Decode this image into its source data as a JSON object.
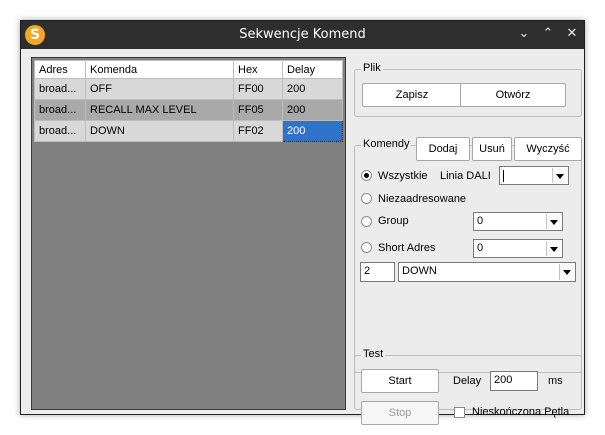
{
  "window": {
    "title": "Sekwencje Komend",
    "icon": "app-logo-icon"
  },
  "table": {
    "columns": [
      "Adres",
      "Komenda",
      "Hex",
      "Delay"
    ],
    "rows": [
      [
        "broad...",
        "OFF",
        "FF00",
        "200"
      ],
      [
        "broad...",
        "RECALL MAX LEVEL",
        "FF05",
        "200"
      ],
      [
        "broad...",
        "DOWN",
        "FF02",
        "200"
      ]
    ],
    "selected_cell": "200"
  },
  "plik": {
    "legend": "Plik",
    "save": "Zapisz",
    "open": "Otwórz"
  },
  "komendy": {
    "legend": "Komendy",
    "add": "Dodaj",
    "remove": "Usuń",
    "clear": "Wyczyść",
    "all_label": "Wszystkie",
    "dali_line_label": "Linia DALI",
    "dali_line_value": "",
    "unaddressed_label": "Niezaadresowane",
    "group_label": "Group",
    "group_value": "0",
    "short_label": "Short Adres",
    "short_value": "0",
    "repeat_value": "2",
    "command_value": "DOWN",
    "selected_mode": "Wszystkie"
  },
  "test": {
    "legend": "Test",
    "start": "Start",
    "stop": "Stop",
    "delay_label": "Delay",
    "delay_value": "200",
    "unit": "ms",
    "loop_label": "Nieskończona Pętla",
    "loop_checked": false
  },
  "colors": {
    "titlebar": "#2e2e2e",
    "selection": "#3072c9",
    "panel": "#808080"
  }
}
